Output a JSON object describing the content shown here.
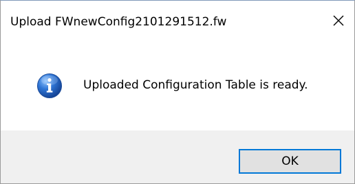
{
  "dialog": {
    "title": "Upload FWnewConfig2101291512.fw",
    "close_icon": "close-icon",
    "message_icon": "information-icon",
    "message": "Uploaded Configuration Table is ready.",
    "ok_label": "OK"
  },
  "colors": {
    "title_background": "#ffffff",
    "content_background": "#ffffff",
    "footer_background": "#f0f0f0",
    "button_focus_border": "#0078d7",
    "button_face": "#e1e1e1",
    "info_icon_blue": "#1f5fbf"
  }
}
